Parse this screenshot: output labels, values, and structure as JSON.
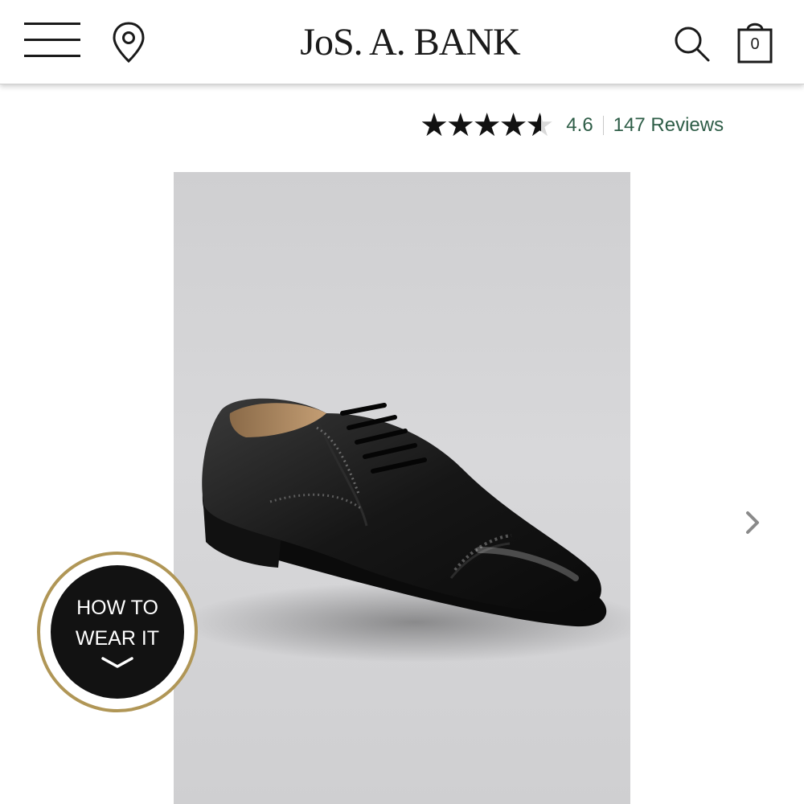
{
  "header": {
    "logo_text": "JoS. A. BANK",
    "bag_count": "0",
    "icons": [
      "menu-icon",
      "location-pin-icon",
      "search-icon",
      "shopping-bag-icon"
    ]
  },
  "rating": {
    "value": "4.6",
    "max": 5,
    "reviews_label": "147 Reviews",
    "star_color": "#111111",
    "link_color": "#2e5d47"
  },
  "product": {
    "image": "black cap-toe oxford dress shoe"
  },
  "badge": {
    "label": "HOW TO\nWEAR IT",
    "ring_color": "#b09656",
    "icon": "chevron-down-icon"
  },
  "carousel": {
    "next_icon": "chevron-right-icon"
  }
}
